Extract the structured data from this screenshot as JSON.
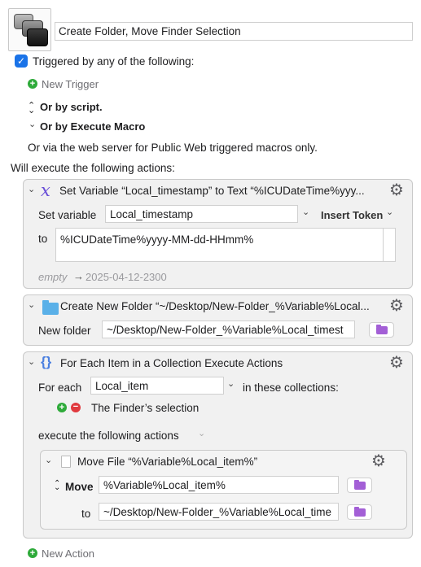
{
  "macro": {
    "name": "Create Folder, Move Finder Selection"
  },
  "triggers": {
    "checkbox_label": "Triggered by any of the following:",
    "new_trigger": "New Trigger",
    "or_by_script": "Or by script.",
    "or_by_execute_macro": "Or by Execute Macro",
    "web_server_note": "Or via the web server for Public Web triggered macros only."
  },
  "actions_heading": "Will execute the following actions:",
  "action1": {
    "title": "Set Variable “Local_timestamp” to Text “%ICUDateTime%yyy...",
    "set_variable_label": "Set variable",
    "variable_value": "Local_timestamp",
    "insert_token": "Insert Token",
    "to_label": "to",
    "text_value": "%ICUDateTime%yyyy-MM-dd-HHmm%",
    "preview_empty": "empty",
    "preview_arrow": "→",
    "preview_result": "2025-04-12-2300"
  },
  "action2": {
    "title": "Create New Folder “~/Desktop/New-Folder_%Variable%Local...",
    "new_folder_label": "New folder",
    "path_value": "~/Desktop/New-Folder_%Variable%Local_timest"
  },
  "action3": {
    "title": "For Each Item in a Collection Execute Actions",
    "for_each_label": "For each",
    "item_variable": "Local_item",
    "collections_label": "in these collections:",
    "collection_item": "The Finder’s selection",
    "execute_label": "execute the following actions",
    "inner": {
      "title": "Move File “%Variable%Local_item%”",
      "mode_label": "Move",
      "source_value": "%Variable%Local_item%",
      "to_label": "to",
      "dest_value": "~/Desktop/New-Folder_%Variable%Local_time"
    }
  },
  "new_action": "New Action",
  "icons": {
    "gear": "gear-icon",
    "variable": "variable-x-icon",
    "folder": "folder-icon",
    "for_each": "curly-braces-icon",
    "file": "file-icon"
  },
  "colors": {
    "accent": "#1a73e8",
    "add": "#2eaa3a",
    "remove": "#e0393e",
    "folder_purple": "#a35fd6",
    "folder_blue": "#5ab0e8",
    "variable_purple": "#6a4fd8"
  }
}
